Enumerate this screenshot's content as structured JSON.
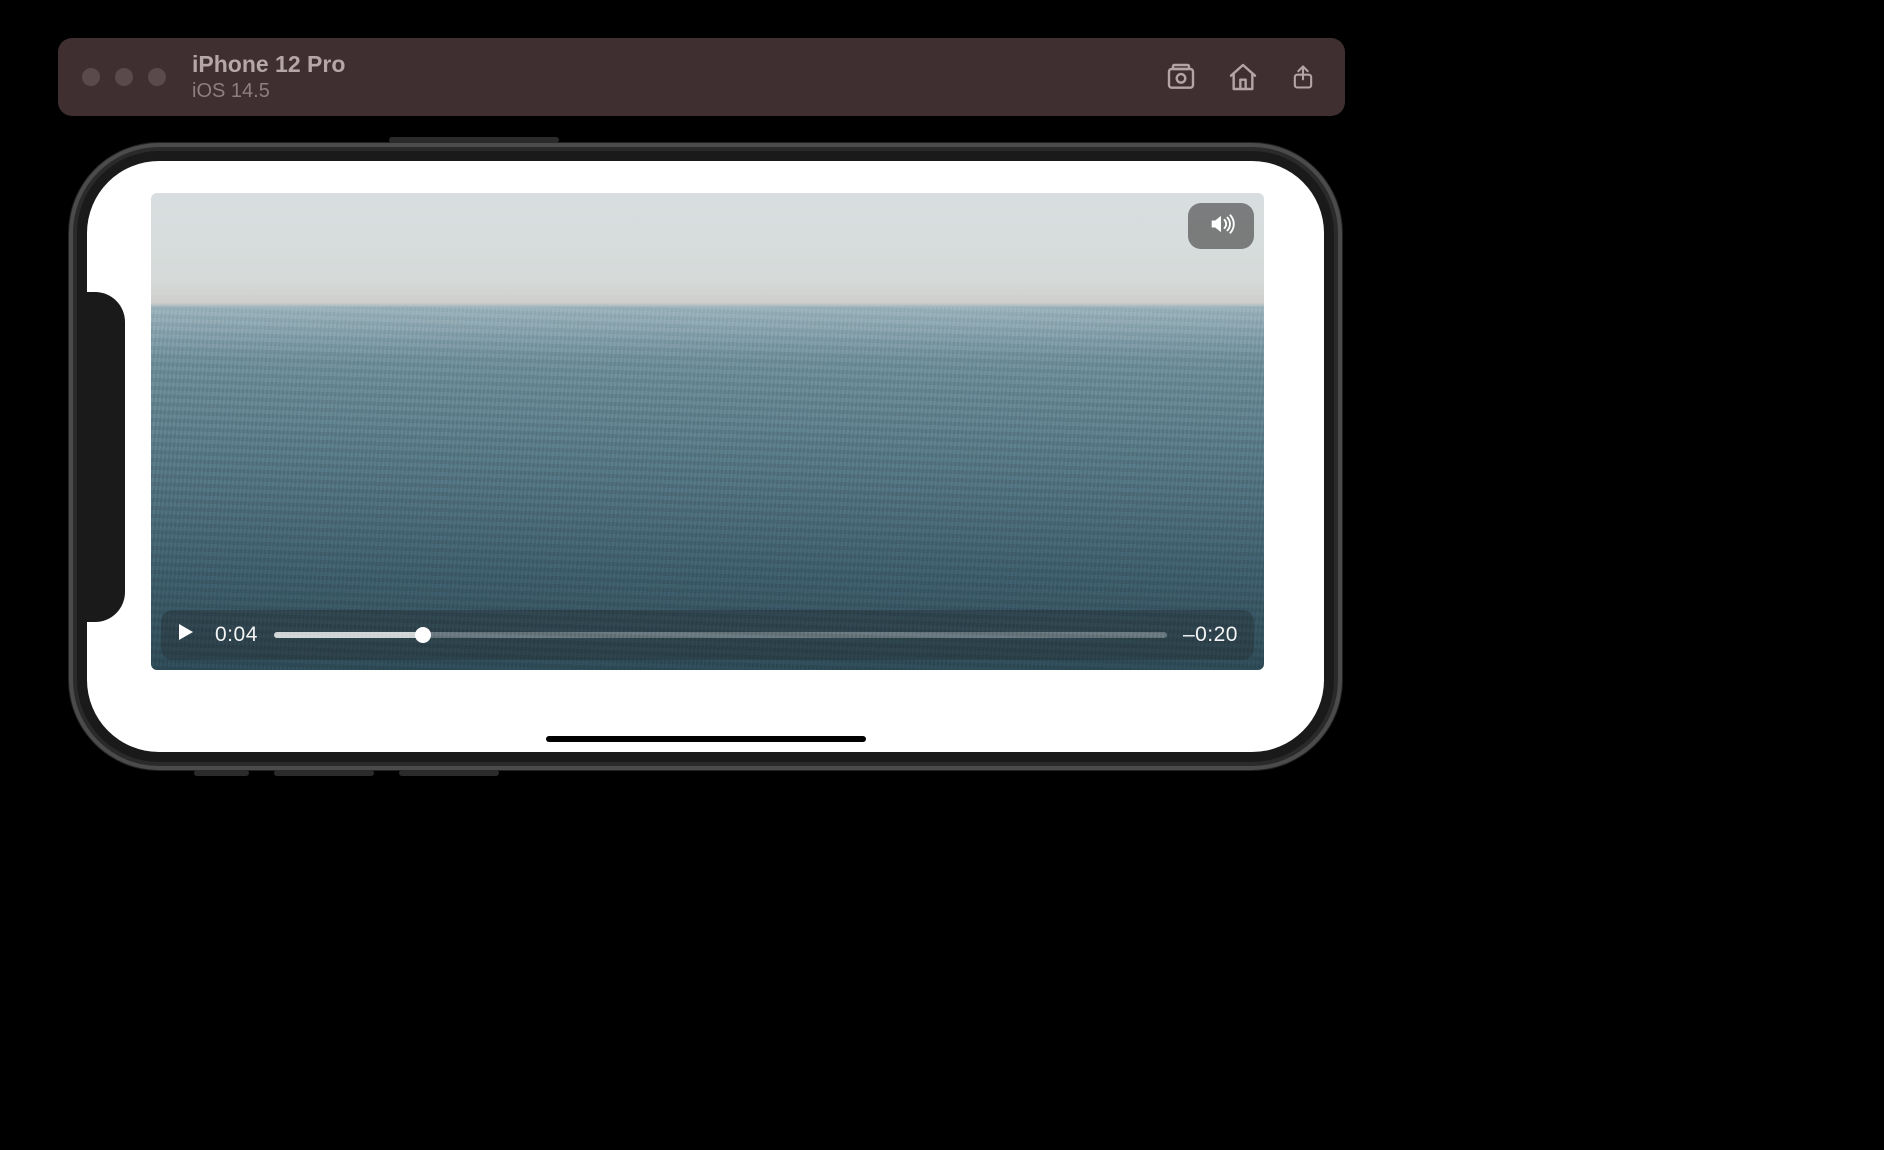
{
  "toolbar": {
    "device_name": "iPhone 12 Pro",
    "device_os": "iOS 14.5",
    "icons": {
      "screenshot": "screenshot-icon",
      "home": "home-icon",
      "share": "share-icon"
    }
  },
  "player": {
    "elapsed": "0:04",
    "remaining": "–0:20",
    "progress_percent": 16.7,
    "volume_icon": "speaker-loud-icon",
    "play_icon": "play-icon"
  }
}
